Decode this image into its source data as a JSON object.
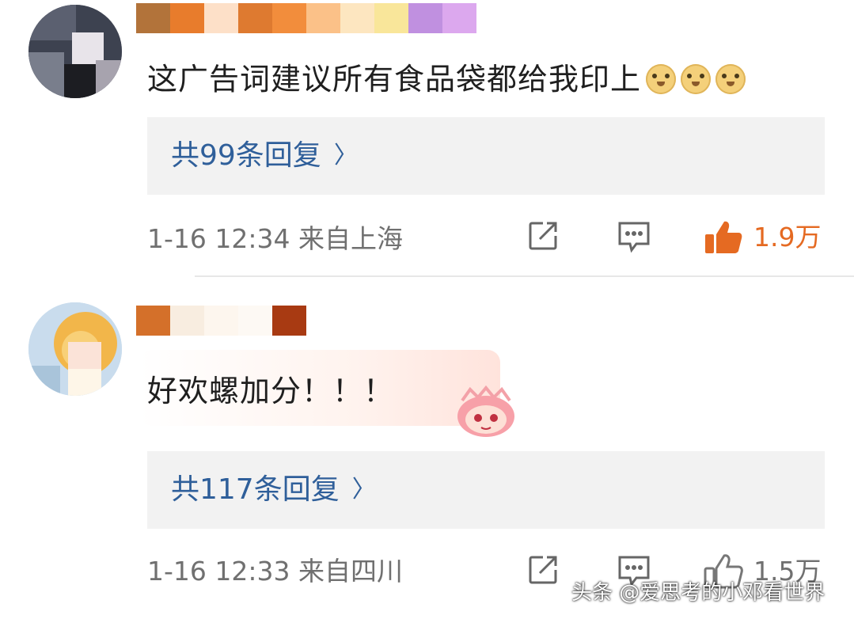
{
  "comments": [
    {
      "text": "这广告词建议所有食品袋都给我印上",
      "emoji": "doge-emoji",
      "replies_label": "共99条回复",
      "timestamp": "1-16 12:34",
      "location": "来自上海",
      "likes": "1.9万",
      "liked": true,
      "name_mosaic_colors": [
        "#b2733a",
        "#e87c2c",
        "#fde0c8",
        "#de7a30",
        "#f28d3c",
        "#fbc188",
        "#fde6c0",
        "#f9e69a",
        "#c090e0",
        "#dca8ee"
      ]
    },
    {
      "text": "好欢螺加分！！！",
      "emoji": "pink-girl-emoji",
      "replies_label": "共117条回复",
      "timestamp": "1-16 12:33",
      "location": "来自四川",
      "likes": "1.5万",
      "liked": false,
      "name_mosaic_colors": [
        "#d4702a",
        "#f8ede0",
        "#fdf6ee",
        "#fdf9f4",
        "#a83a12"
      ]
    }
  ],
  "icons": {
    "share": "share-icon",
    "comment": "comment-icon",
    "like": "thumbs-up-icon",
    "chevron": "chevron-right-icon"
  },
  "chevron_glyph": "〉",
  "watermark": "头条 @爱思考的小邓看世界",
  "colors": {
    "reply_link": "#2f5f9a",
    "liked": "#e56a22",
    "meta": "#707070",
    "reply_bg": "#f2f2f2"
  }
}
